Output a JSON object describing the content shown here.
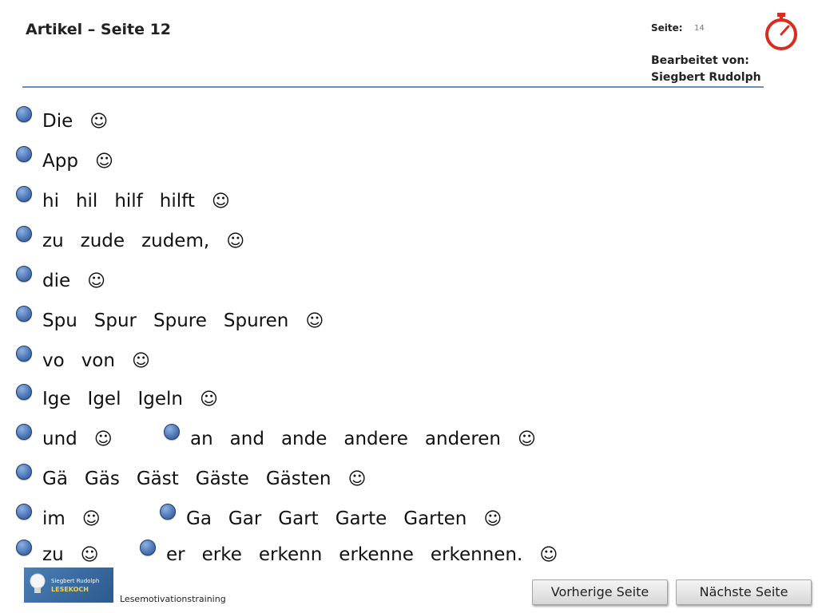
{
  "header": {
    "title": "Artikel – Seite 12",
    "page_label": "Seite:",
    "page_number": "14",
    "edited_by_label": "Bearbeitet von:",
    "edited_by_name": "Siegbert Rudolph"
  },
  "smiley": "☺",
  "rows": [
    {
      "segments": [
        {
          "words": [
            "Die"
          ]
        }
      ]
    },
    {
      "segments": [
        {
          "words": [
            "App"
          ]
        }
      ]
    },
    {
      "segments": [
        {
          "words": [
            "hi",
            "hil",
            "hilf",
            "hilft"
          ]
        }
      ]
    },
    {
      "segments": [
        {
          "words": [
            "zu",
            "zude",
            "zudem,"
          ]
        }
      ]
    },
    {
      "segments": [
        {
          "words": [
            "die"
          ]
        }
      ]
    },
    {
      "segments": [
        {
          "words": [
            "Spu",
            "Spur",
            "Spure",
            "Spuren"
          ]
        }
      ]
    },
    {
      "segments": [
        {
          "words": [
            "vo",
            "von"
          ]
        }
      ]
    },
    {
      "segments": [
        {
          "words": [
            "Ige",
            "Igel",
            "Igeln"
          ]
        }
      ]
    },
    {
      "segments": [
        {
          "words": [
            "und"
          ]
        },
        {
          "words": [
            "an",
            "and",
            "ande",
            "andere",
            "anderen"
          ]
        }
      ]
    },
    {
      "segments": [
        {
          "words": [
            "Gä",
            "Gäs",
            "Gäst",
            "Gäste",
            "Gästen"
          ]
        }
      ]
    },
    {
      "segments": [
        {
          "words": [
            "im"
          ]
        },
        {
          "words": [
            "Ga",
            "Gar",
            "Gart",
            "Garte",
            "Garten"
          ]
        }
      ]
    },
    {
      "segments": [
        {
          "words": [
            "zu"
          ]
        },
        {
          "words": [
            "er",
            "erke",
            "erkenn",
            "erkenne",
            "erkennen."
          ]
        }
      ]
    }
  ],
  "footer": {
    "logo_line1": "Siegbert Rudolph",
    "logo_line2": "LESEKOCH",
    "caption": "Lesemotivationstraining",
    "prev_button": "Vorherige Seite",
    "next_button": "Nächste Seite"
  }
}
